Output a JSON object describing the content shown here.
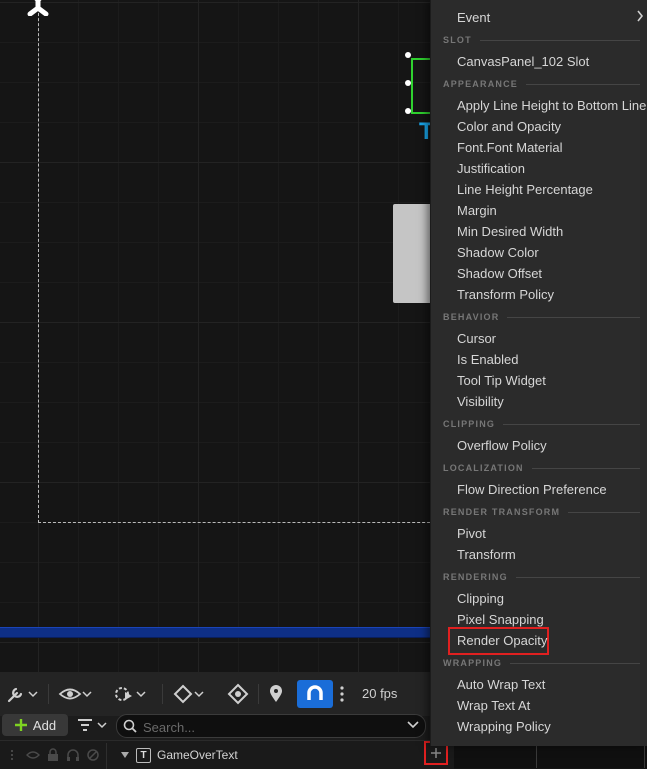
{
  "toolbar": {
    "fps_label": "20 fps",
    "add_label": "Add",
    "search_placeholder": "Search..."
  },
  "canvas": {
    "text_glyph": "T"
  },
  "hierarchy": {
    "row_label": "GameOverText",
    "row_type_glyph": "T"
  },
  "menu": {
    "event": "Event",
    "sections": {
      "slot": "SLOT",
      "appearance": "APPEARANCE",
      "behavior": "BEHAVIOR",
      "clipping": "CLIPPING",
      "localization": "LOCALIZATION",
      "render_transform": "RENDER TRANSFORM",
      "rendering": "RENDERING",
      "wrapping": "WRAPPING"
    },
    "slot_items": [
      "CanvasPanel_102 Slot"
    ],
    "appearance_items": [
      "Apply Line Height to Bottom Line",
      "Color and Opacity",
      "Font.Font Material",
      "Justification",
      "Line Height Percentage",
      "Margin",
      "Min Desired Width",
      "Shadow Color",
      "Shadow Offset",
      "Transform Policy"
    ],
    "behavior_items": [
      "Cursor",
      "Is Enabled",
      "Tool Tip Widget",
      "Visibility"
    ],
    "clipping_items": [
      "Overflow Policy"
    ],
    "localization_items": [
      "Flow Direction Preference"
    ],
    "render_transform_items": [
      "Pivot",
      "Transform"
    ],
    "rendering_items": [
      "Clipping",
      "Pixel Snapping",
      "Render Opacity"
    ],
    "wrapping_items": [
      "Auto Wrap Text",
      "Wrap Text At",
      "Wrapping Policy"
    ]
  },
  "colors": {
    "accent_blue": "#1a6dd8",
    "selection_green": "#2fd12f",
    "highlight_red": "#e02020",
    "text_widget_blue": "#19a6ea"
  }
}
